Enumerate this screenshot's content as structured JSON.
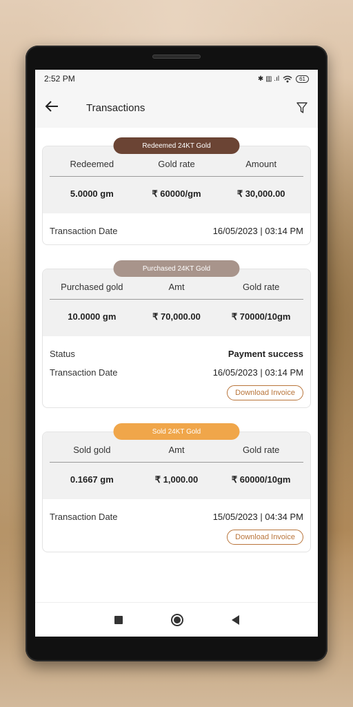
{
  "status": {
    "time": "2:52 PM",
    "battery": "61",
    "icons_text": "✱ ▥ .ıl"
  },
  "header": {
    "title": "Transactions",
    "back_icon": "arrow-left-icon",
    "filter_icon": "filter-icon"
  },
  "transactions": [
    {
      "type": "Redeemed 24KT Gold",
      "pill_color": "#6b4434",
      "columns": [
        "Redeemed",
        "Gold rate",
        "Amount"
      ],
      "values": [
        "5.0000 gm",
        "₹ 60000/gm",
        "₹ 30,000.00"
      ],
      "date_label": "Transaction Date",
      "date": "16/05/2023 | 03:14 PM"
    },
    {
      "type": "Purchased 24KT Gold",
      "pill_color": "#a8948b",
      "columns": [
        "Purchased gold",
        "Amt",
        "Gold rate"
      ],
      "values": [
        "10.0000 gm",
        "₹ 70,000.00",
        "₹ 70000/10gm"
      ],
      "status_label": "Status",
      "status": "Payment success",
      "date_label": "Transaction Date",
      "date": "16/05/2023 | 03:14 PM",
      "invoice": "Download Invoice"
    },
    {
      "type": "Sold 24KT Gold",
      "pill_color": "#f0a64a",
      "columns": [
        "Sold gold",
        "Amt",
        "Gold rate"
      ],
      "values": [
        "0.1667 gm",
        "₹ 1,000.00",
        "₹ 60000/10gm"
      ],
      "date_label": "Transaction Date",
      "date": "15/05/2023 | 04:34 PM",
      "invoice": "Download Invoice"
    }
  ],
  "colors": {
    "accent": "#b8743a"
  }
}
